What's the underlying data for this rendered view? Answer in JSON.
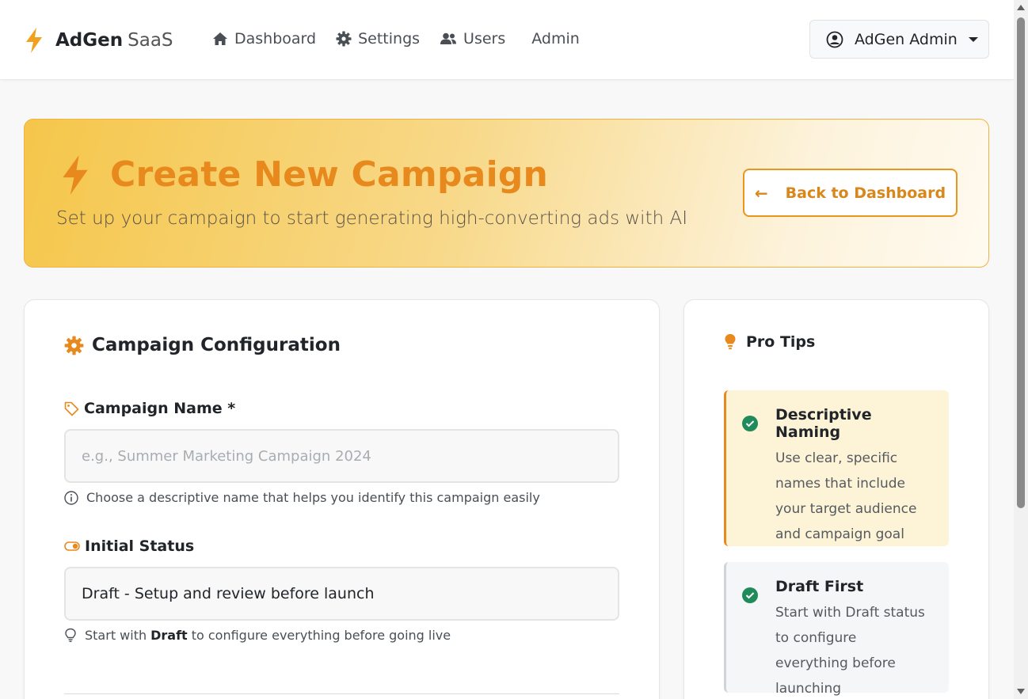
{
  "brand": {
    "name": "AdGen",
    "suffix": "SaaS"
  },
  "nav": {
    "items": [
      {
        "label": "Dashboard",
        "icon": "home-icon"
      },
      {
        "label": "Settings",
        "icon": "gear-icon"
      },
      {
        "label": "Users",
        "icon": "users-icon"
      },
      {
        "label": "Admin",
        "icon": ""
      }
    ],
    "user_label": "AdGen Admin"
  },
  "hero": {
    "title": "Create New Campaign",
    "subtitle": "Set up your campaign to start generating high-converting ads with AI",
    "back_label": "Back to Dashboard"
  },
  "form": {
    "section_title": "Campaign Configuration",
    "name_label": "Campaign Name *",
    "name_placeholder": "e.g., Summer Marketing Campaign 2024",
    "name_value": "",
    "name_help": "Choose a descriptive name that helps you identify this campaign easily",
    "status_label": "Initial Status",
    "status_value": "Draft - Setup and review before launch",
    "status_help_prefix": "Start with",
    "status_help_bold": "Draft",
    "status_help_suffix": "to configure everything before going live"
  },
  "tips": {
    "title": "Pro Tips",
    "items": [
      {
        "title": "Descriptive Naming",
        "text": "Use clear, specific names that include your target audience and campaign goal"
      },
      {
        "title": "Draft First",
        "text": "Start with Draft status to configure everything before launching"
      }
    ]
  },
  "colors": {
    "accent": "#e8891e",
    "hero_gradient_start": "#f5c64a",
    "success": "#1f8a5a"
  }
}
